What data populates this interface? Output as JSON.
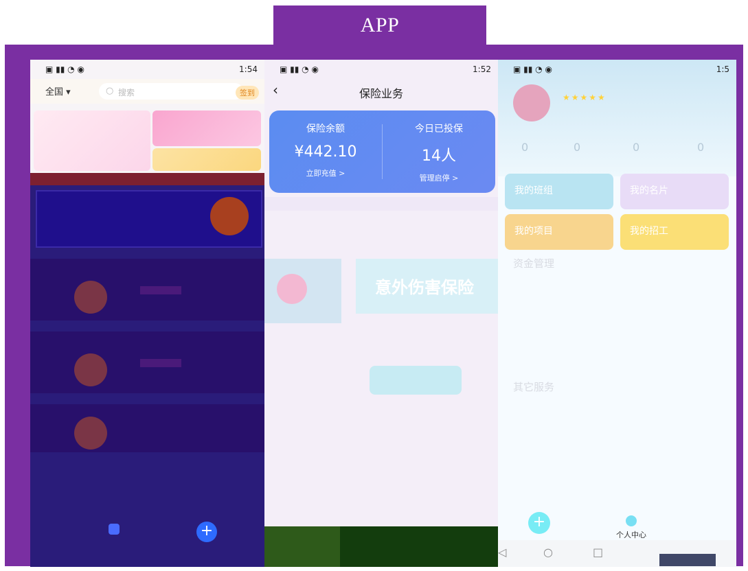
{
  "tab": {
    "label": "APP"
  },
  "screen1": {
    "status_time": "1:54",
    "location": "全国",
    "search_placeholder": "搜索",
    "sign_in": "签到",
    "banner_text": ""
  },
  "screen2": {
    "status_time": "1:52",
    "title": "保险业务",
    "balance_label": "保险余额",
    "balance_value": "¥442.10",
    "recharge": "立即充值 >",
    "today_label": "今日已投保",
    "today_value": "14人",
    "manage": "管理启停 >",
    "promo_text": "意外伤害保险"
  },
  "screen3": {
    "status_time": "1:5",
    "stars": "★★★★★",
    "stats": [
      "0",
      "0",
      "0",
      "0"
    ],
    "tiles": {
      "team": "我的班组",
      "card": "我的名片",
      "project": "我的项目",
      "recruit": "我的招工"
    },
    "fund": "资金管理",
    "other": "其它服务",
    "center": "个人中心",
    "nav": {
      "back": "◁",
      "home": "○",
      "recent": "□"
    }
  },
  "colors": {
    "frame": "#7a2fa2",
    "card_blue": "#5b8cf1"
  }
}
